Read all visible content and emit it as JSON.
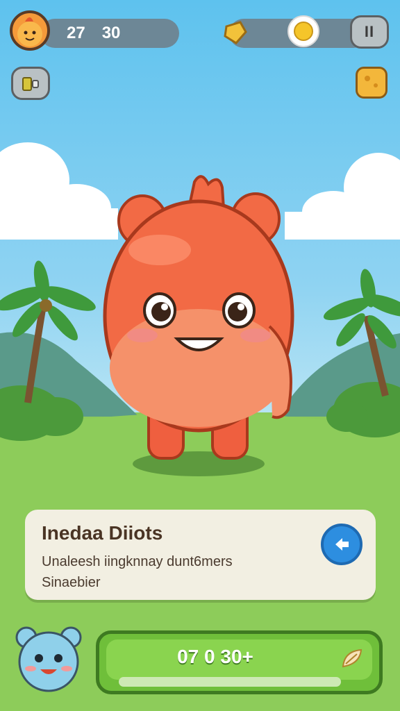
{
  "hud": {
    "stat_a": "27",
    "stat_b": "30",
    "pause_label": "II"
  },
  "info_panel": {
    "title": "Inedaa Diiots",
    "line1": "Unaleesh iingknnay dunt6mers",
    "line2": "Sinaebier"
  },
  "bottom": {
    "value": "07 0 30+"
  },
  "icons": {
    "avatar": "chick-avatar-icon",
    "gem": "gold-gem-icon",
    "sun": "sun-icon",
    "pause": "pause-icon",
    "left_tool": "tool-icon",
    "right_item": "cheese-icon",
    "info_action": "back-arrow-icon",
    "bear": "bear-avatar-icon",
    "leaf": "leaf-icon"
  },
  "colors": {
    "character": "#f26a45",
    "sky": "#5ec2ee",
    "grass": "#7dbf4d",
    "panel": "#f2efe2",
    "action_button": "#2d8ee0",
    "bottom_bar": "#6fbf3a"
  }
}
